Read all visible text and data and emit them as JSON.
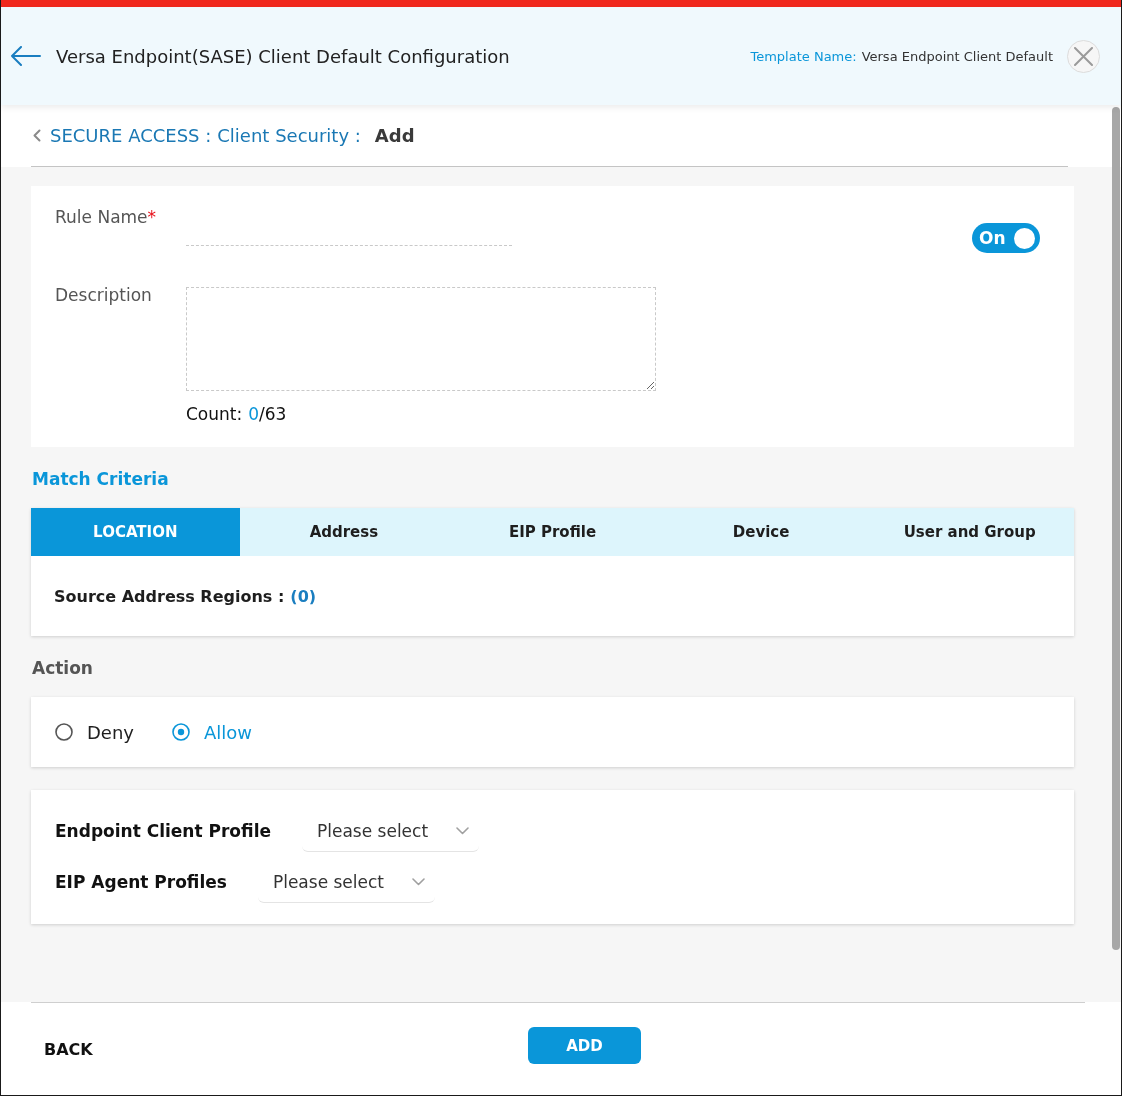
{
  "header": {
    "title": "Versa Endpoint(SASE) Client Default Configuration",
    "template_label": "Template Name:",
    "template_value": "Versa Endpoint Client Default"
  },
  "breadcrumb": {
    "links": [
      "SECURE ACCESS :",
      "Client Security :"
    ],
    "current": "Add"
  },
  "form": {
    "rule_name": {
      "label": "Rule Name",
      "required_mark": "*"
    },
    "toggle": {
      "label": "On",
      "on": true
    },
    "description": {
      "label": "Description"
    },
    "count": {
      "label": "Count:",
      "value": "0",
      "limit": "/63"
    }
  },
  "match_criteria": {
    "title": "Match Criteria",
    "tabs": [
      {
        "label": "LOCATION",
        "selected": true
      },
      {
        "label": "Address",
        "selected": false
      },
      {
        "label": "EIP Profile",
        "selected": false
      },
      {
        "label": "Device",
        "selected": false
      },
      {
        "label": "User and Group",
        "selected": false
      }
    ],
    "content": {
      "label": "Source Address Regions :",
      "count": "(0)"
    }
  },
  "action": {
    "title": "Action",
    "options": [
      {
        "label": "Deny",
        "selected": false
      },
      {
        "label": "Allow",
        "selected": true
      }
    ]
  },
  "profiles": [
    {
      "label": "Endpoint Client Profile",
      "placeholder": "Please select"
    },
    {
      "label": "EIP Agent Profiles",
      "placeholder": "Please select"
    }
  ],
  "footer": {
    "back": "BACK",
    "add": "ADD"
  }
}
